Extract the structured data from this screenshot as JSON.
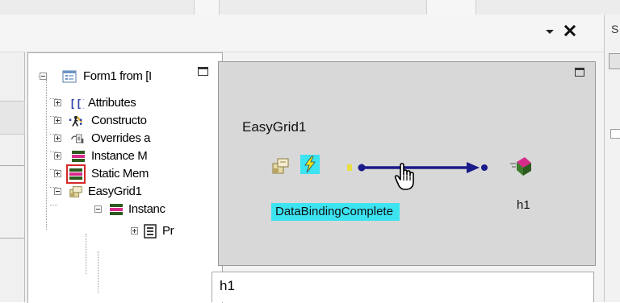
{
  "tree": {
    "items": [
      {
        "label": "Form1 from [I",
        "icon": "form-icon",
        "expander": "minus"
      },
      {
        "label": "Attributes",
        "icon": "attributes-icon",
        "expander": "plus"
      },
      {
        "label": "Constructo",
        "icon": "constructor-icon",
        "expander": "plus"
      },
      {
        "label": "Overrides a",
        "icon": "overrides-icon",
        "expander": "plus"
      },
      {
        "label": "Instance M",
        "icon": "instance-methods-icon",
        "expander": "plus"
      },
      {
        "label": "Static Mem",
        "icon": "static-members-icon",
        "expander": "plus"
      },
      {
        "label": "EasyGrid1",
        "icon": "component-icon",
        "expander": "minus"
      },
      {
        "label": "Instanc",
        "icon": "instance-methods-icon",
        "expander": "minus"
      },
      {
        "label": "Pr",
        "icon": "properties-icon",
        "expander": "plus"
      }
    ]
  },
  "designer": {
    "component_name": "EasyGrid1",
    "event_name": "DataBindingComplete",
    "target_name": "h1",
    "colors": {
      "background": "#d8d8d8",
      "event_highlight": "#3ce3f1",
      "connector": "#1a1a8a"
    }
  },
  "output": {
    "text": "h1"
  },
  "right_panel": {
    "label": "S"
  },
  "header": {
    "dropdown_icon": "chevron-down-icon",
    "close_icon": "close-icon"
  }
}
